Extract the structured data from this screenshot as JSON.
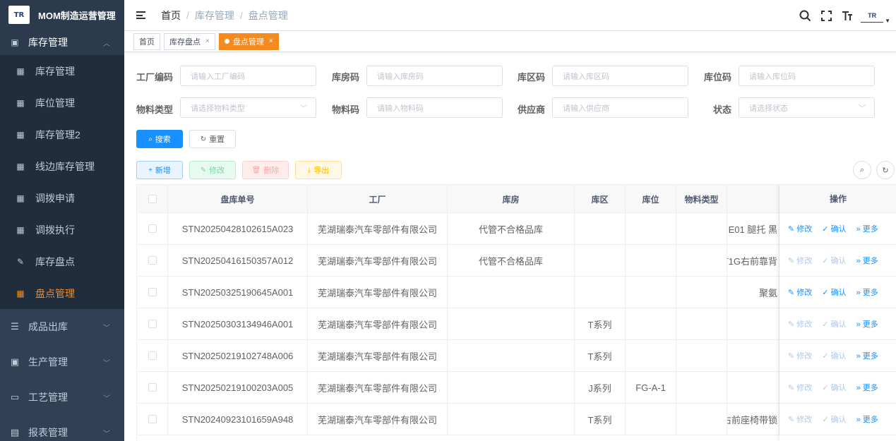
{
  "app": {
    "logo_text": "TR",
    "title": "MOM制造运营管理"
  },
  "sidebar": {
    "open_group": {
      "label": "库存管理"
    },
    "items": [
      {
        "label": "库存管理",
        "icon": "table-icon"
      },
      {
        "label": "库位管理",
        "icon": "table-icon"
      },
      {
        "label": "库存管理2",
        "icon": "table-icon"
      },
      {
        "label": "线边库存管理",
        "icon": "table-icon"
      },
      {
        "label": "调拨申请",
        "icon": "table-icon"
      },
      {
        "label": "调拨执行",
        "icon": "table-icon"
      },
      {
        "label": "库存盘点",
        "icon": "edit-icon"
      },
      {
        "label": "盘点管理",
        "icon": "table-icon",
        "active": true
      }
    ],
    "groups": [
      {
        "label": "成品出库",
        "icon": "list-icon"
      },
      {
        "label": "生产管理",
        "icon": "monitor-icon"
      },
      {
        "label": "工艺管理",
        "icon": "message-icon"
      },
      {
        "label": "报表管理",
        "icon": "chart-icon"
      }
    ]
  },
  "navbar": {
    "breadcrumb": [
      "首页",
      "库存管理",
      "盘点管理"
    ],
    "avatar_text": "TR"
  },
  "tags": [
    {
      "label": "首页"
    },
    {
      "label": "库存盘点"
    },
    {
      "label": "盘点管理"
    }
  ],
  "form": {
    "factory_label": "工厂编码",
    "factory_placeholder": "请输入工厂编码",
    "warehouse_label": "库房码",
    "warehouse_placeholder": "请输入库房码",
    "area_label": "库区码",
    "area_placeholder": "请输入库区码",
    "location_label": "库位码",
    "location_placeholder": "请输入库位码",
    "material_type_label": "物料类型",
    "material_type_placeholder": "请选择物料类型",
    "material_label": "物料码",
    "material_placeholder": "请输入物料码",
    "supplier_label": "供应商",
    "supplier_placeholder": "请输入供应商",
    "status_label": "状态",
    "status_placeholder": "请选择状态",
    "search_label": "搜索",
    "reset_label": "重置"
  },
  "toolbar": {
    "add": "新增",
    "edit": "修改",
    "delete": "删除",
    "export": "导出"
  },
  "table": {
    "columns": [
      "盘库单号",
      "工厂",
      "库房",
      "库区",
      "库位",
      "物料类型",
      "",
      "操作"
    ],
    "rows": [
      {
        "no": "STN20250428102615A023",
        "factory": "芜湖瑞泰汽车零部件有限公司",
        "warehouse": "代管不合格品库",
        "area": "",
        "location": "",
        "mtype": "",
        "material": "E01 腿托 黑",
        "ops_enabled": true
      },
      {
        "no": "STN20250416150357A012",
        "factory": "芜湖瑞泰汽车零部件有限公司",
        "warehouse": "代管不合格品库",
        "area": "",
        "location": "",
        "mtype": "",
        "material": "T1G右前靠背",
        "ops_enabled": false
      },
      {
        "no": "STN20250325190645A001",
        "factory": "芜湖瑞泰汽车零部件有限公司",
        "warehouse": "",
        "area": "",
        "location": "",
        "mtype": "",
        "material": "聚氨",
        "ops_enabled": true
      },
      {
        "no": "STN20250303134946A001",
        "factory": "芜湖瑞泰汽车零部件有限公司",
        "warehouse": "",
        "area": "T系列",
        "location": "",
        "mtype": "",
        "material": "",
        "ops_enabled": false
      },
      {
        "no": "STN20250219102748A006",
        "factory": "芜湖瑞泰汽车零部件有限公司",
        "warehouse": "",
        "area": "T系列",
        "location": "",
        "mtype": "",
        "material": "",
        "ops_enabled": false
      },
      {
        "no": "STN20250219100203A005",
        "factory": "芜湖瑞泰汽车零部件有限公司",
        "warehouse": "",
        "area": "J系列",
        "location": "FG-A-1",
        "mtype": "",
        "material": "",
        "ops_enabled": false
      },
      {
        "no": "STN20240923101659A948",
        "factory": "芜湖瑞泰汽车零部件有限公司",
        "warehouse": "",
        "area": "T系列",
        "location": "",
        "mtype": "",
        "material": "右前座椅带锁",
        "ops_enabled": false
      }
    ],
    "op_labels": {
      "edit": "修改",
      "confirm": "确认",
      "more": "更多"
    }
  },
  "colors": {
    "sidebar_bg": "#304156",
    "active_orange": "#f58a1f",
    "primary_blue": "#1890ff"
  }
}
